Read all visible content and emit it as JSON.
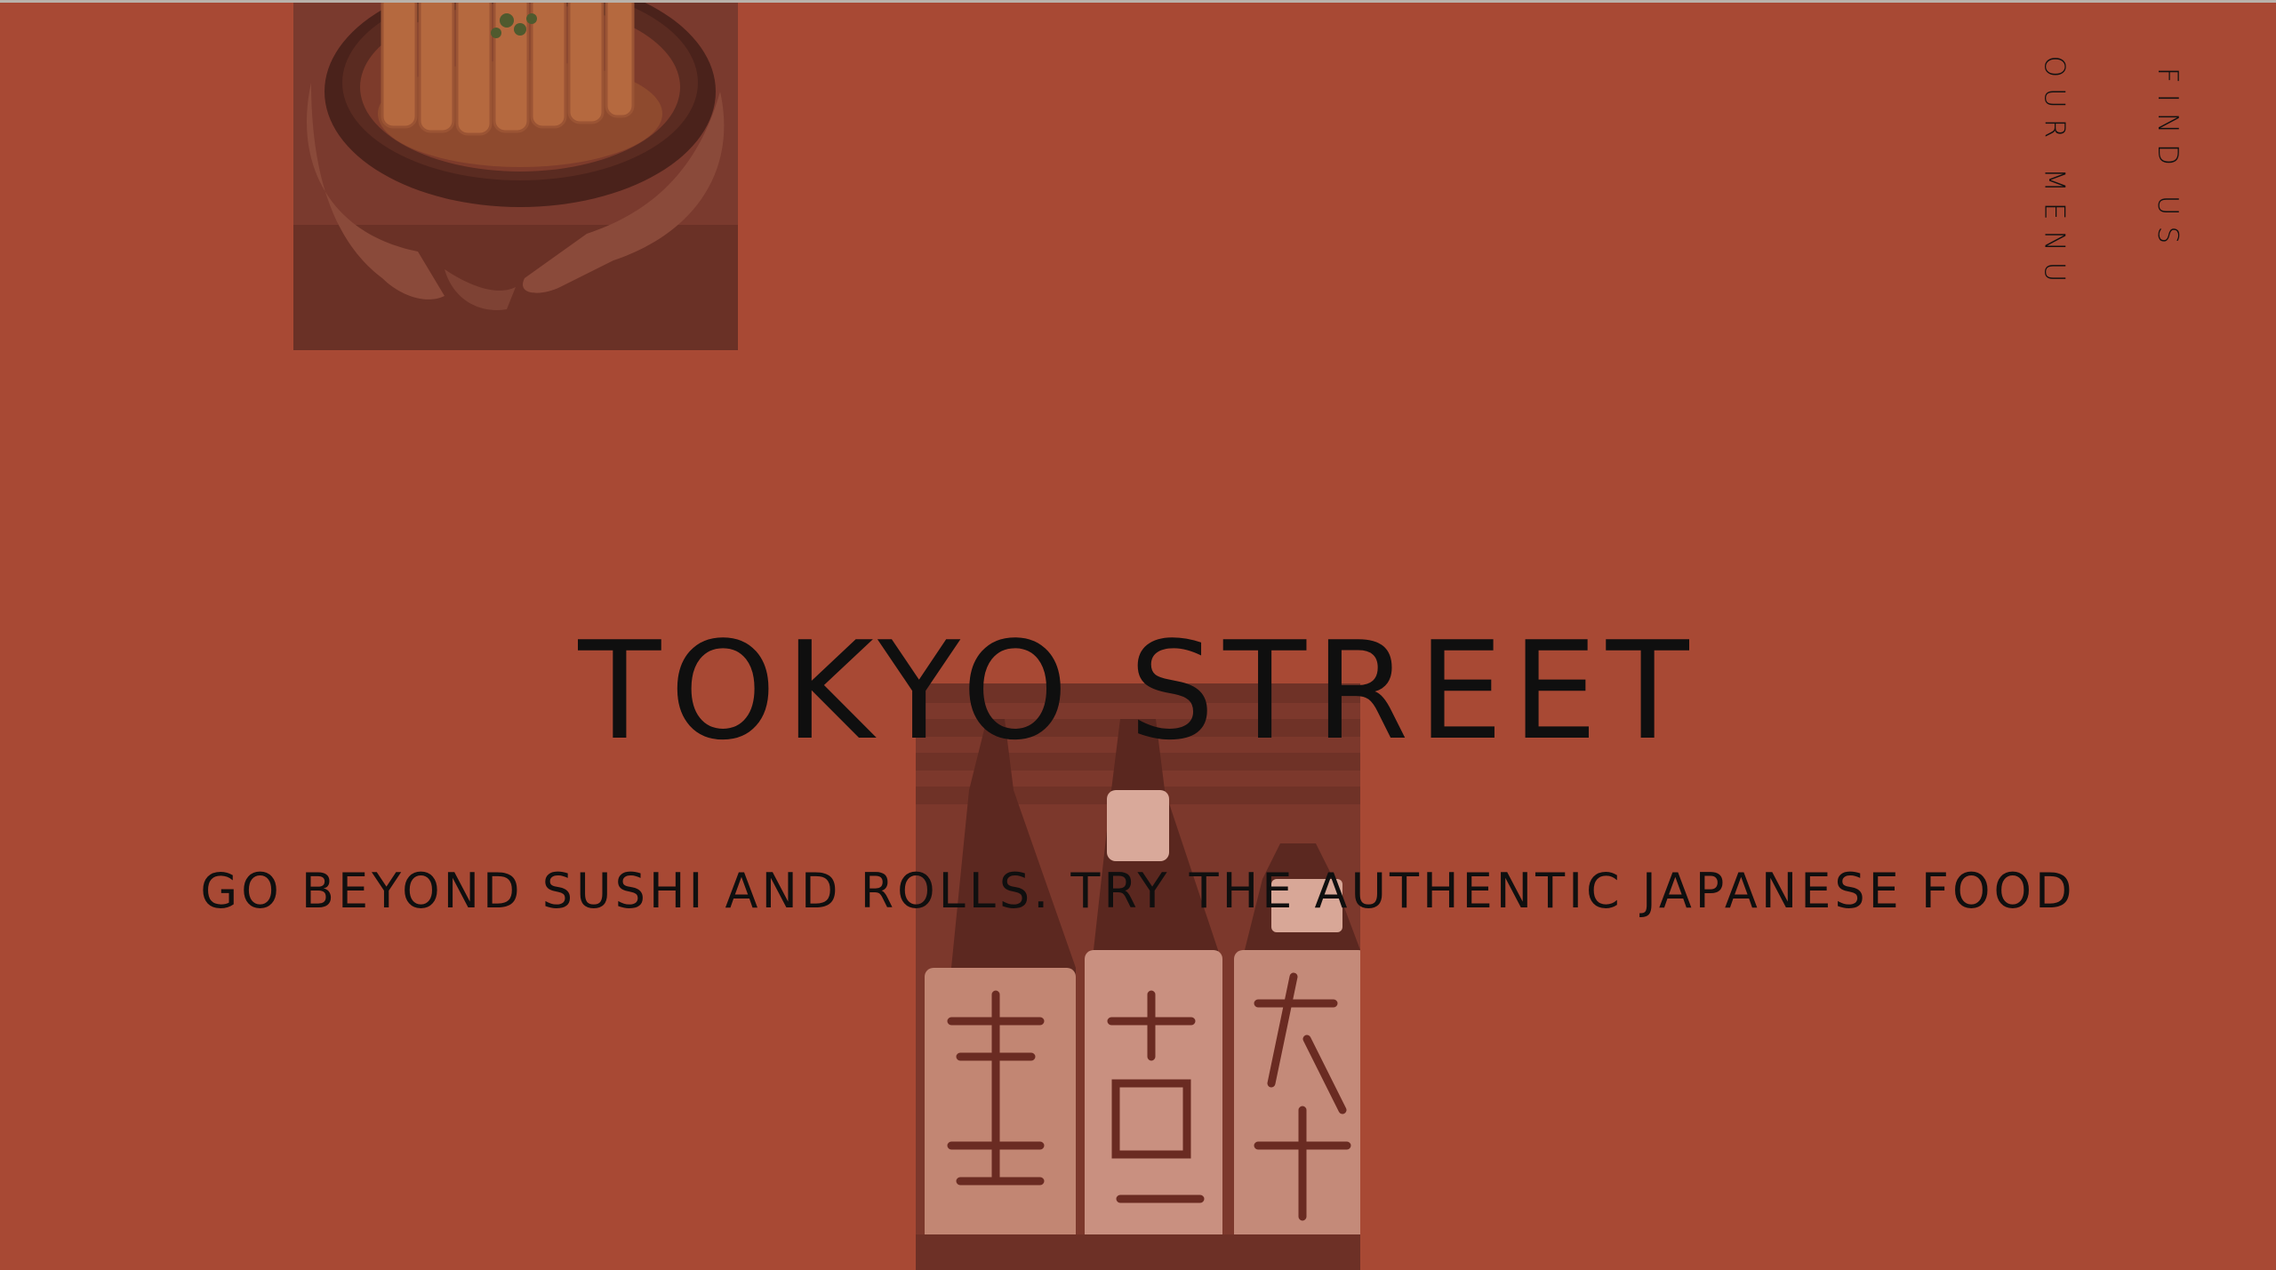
{
  "brand": {
    "title": "TOKYO STREET",
    "tagline": "GO BEYOND SUSHI AND ROLLS. TRY THE AUTHENTIC JAPANESE FOOD"
  },
  "nav": {
    "menu_label": "OUR MENU",
    "find_label": "FIND US"
  },
  "images": {
    "hero_top": "tonkatsu-bowl-photo",
    "hero_bottom": "sake-bottles-photo"
  },
  "colors": {
    "background": "#a84934",
    "text": "#0f0f0f",
    "top_rule": "#b9b2ab"
  }
}
